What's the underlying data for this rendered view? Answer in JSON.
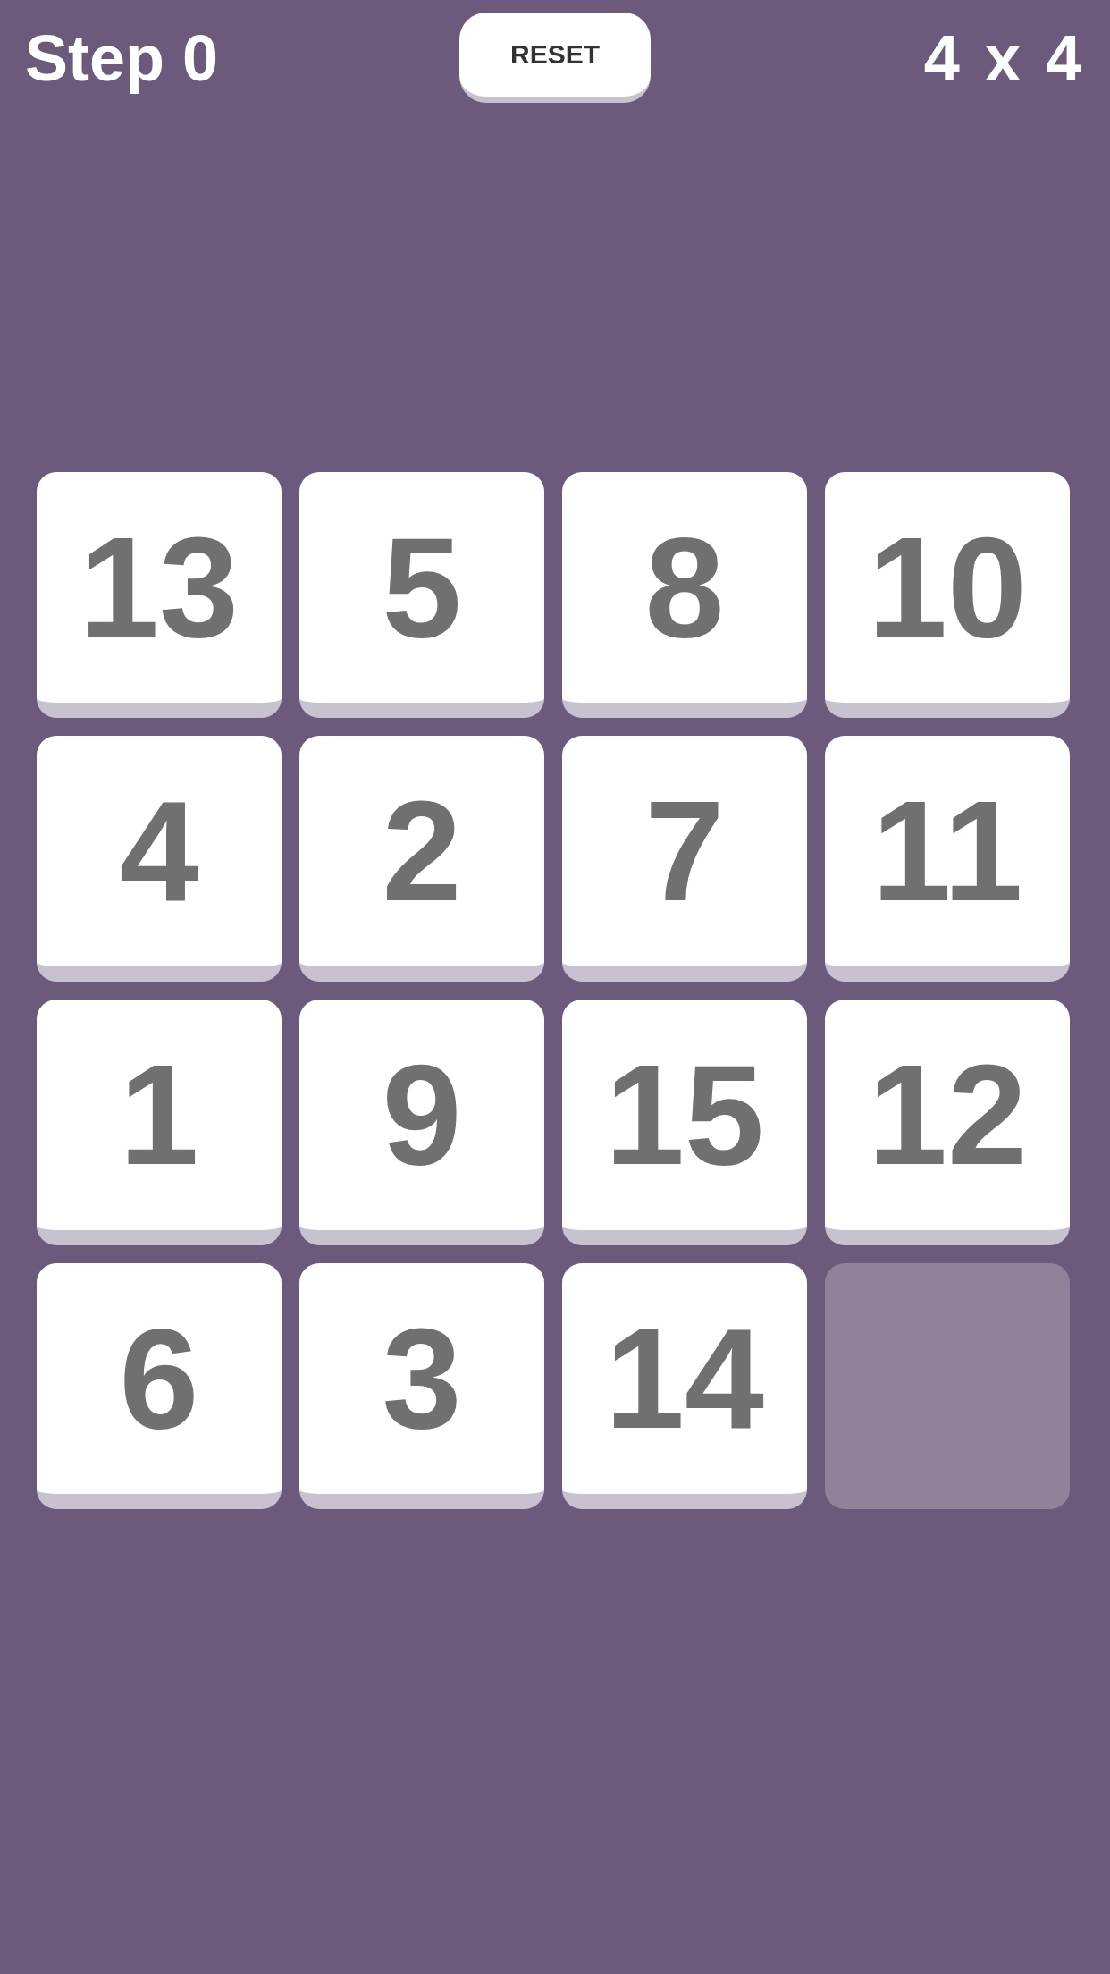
{
  "header": {
    "step_counter": "Step 0",
    "reset_button": "RESET",
    "grid_size": "4 x 4"
  },
  "board": {
    "tiles": [
      {
        "kind": "number",
        "label": "13"
      },
      {
        "kind": "number",
        "label": "5"
      },
      {
        "kind": "number",
        "label": "8"
      },
      {
        "kind": "number",
        "label": "10"
      },
      {
        "kind": "number",
        "label": "4"
      },
      {
        "kind": "number",
        "label": "2"
      },
      {
        "kind": "number",
        "label": "7"
      },
      {
        "kind": "number",
        "label": "11"
      },
      {
        "kind": "number",
        "label": "1"
      },
      {
        "kind": "number",
        "label": "9"
      },
      {
        "kind": "number",
        "label": "15"
      },
      {
        "kind": "number",
        "label": "12"
      },
      {
        "kind": "number",
        "label": "6"
      },
      {
        "kind": "number",
        "label": "3"
      },
      {
        "kind": "number",
        "label": "14"
      },
      {
        "kind": "empty"
      }
    ]
  }
}
